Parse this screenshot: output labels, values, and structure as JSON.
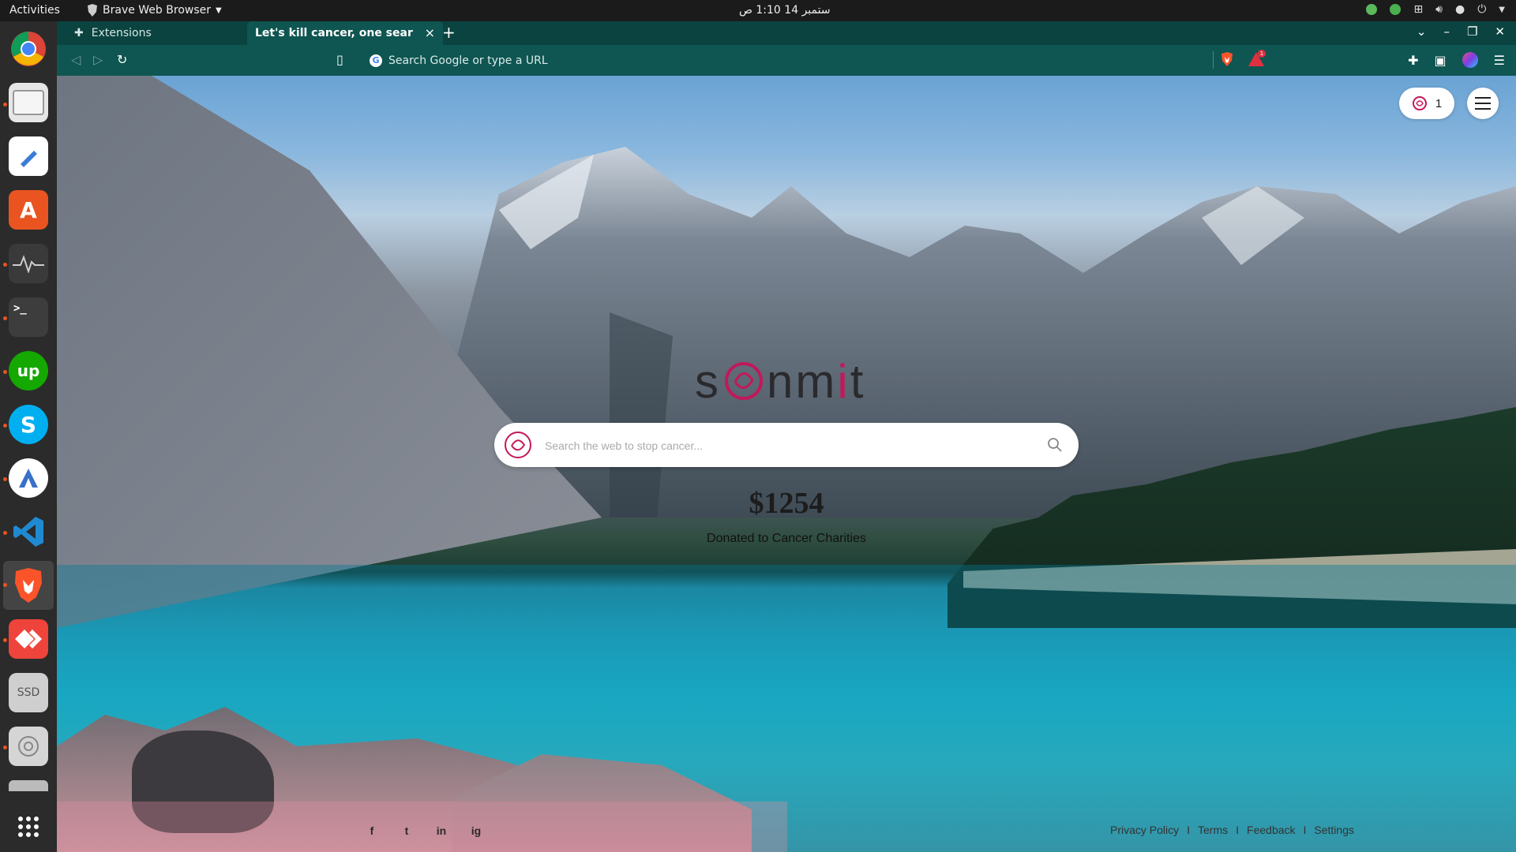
{
  "system_bar": {
    "activities": "Activities",
    "app_name": "Brave Web Browser",
    "clock": "ستمبر 14  1:10 ص"
  },
  "dock": {
    "items": [
      {
        "name": "Google Chrome",
        "icon": "chrome-icon"
      },
      {
        "name": "Files",
        "icon": "files-icon"
      },
      {
        "name": "Text Editor",
        "icon": "text-editor-icon"
      },
      {
        "name": "Ubuntu Software",
        "icon": "software-store-icon"
      },
      {
        "name": "System Monitor",
        "icon": "system-monitor-icon"
      },
      {
        "name": "Terminal",
        "icon": "terminal-icon"
      },
      {
        "name": "Upwork",
        "icon": "upwork-icon",
        "label": "up"
      },
      {
        "name": "Skype",
        "icon": "skype-icon",
        "label": "S"
      },
      {
        "name": "Android Studio",
        "icon": "android-studio-icon"
      },
      {
        "name": "Visual Studio Code",
        "icon": "vscode-icon"
      },
      {
        "name": "Brave Browser",
        "icon": "brave-icon"
      },
      {
        "name": "AnyDesk",
        "icon": "anydesk-icon"
      },
      {
        "name": "SSD Drive",
        "icon": "ssd-drive-icon",
        "label": "SSD"
      },
      {
        "name": "Disk",
        "icon": "disk-icon"
      },
      {
        "name": "Drive",
        "icon": "drive-icon"
      },
      {
        "name": "Show Applications",
        "icon": "app-grid-icon"
      }
    ]
  },
  "browser": {
    "tabs": [
      {
        "label": "Extensions",
        "active": false
      },
      {
        "label": "Let's kill cancer, one search at",
        "active": true
      }
    ],
    "new_tab": "+",
    "address": {
      "placeholder": "Search Google or type a URL"
    },
    "rewards_badge": "1"
  },
  "page": {
    "logo_prefix": "s",
    "logo_mid": "nm",
    "logo_i": "i",
    "logo_suffix": "t",
    "search_placeholder": "Search the web to stop cancer...",
    "amount": "$1254",
    "donated_label": "Donated to Cancer Charities",
    "counter": "1",
    "social": [
      "f",
      "t",
      "in",
      "ig"
    ],
    "footer_links": [
      "Privacy Policy",
      "Terms",
      "Feedback",
      "Settings"
    ],
    "footer_sep": "I"
  },
  "colors": {
    "tab_strip": "#0a4340",
    "toolbar": "#0f5551",
    "dock": "#2b2b2b",
    "accent_pink": "#c2185b"
  }
}
